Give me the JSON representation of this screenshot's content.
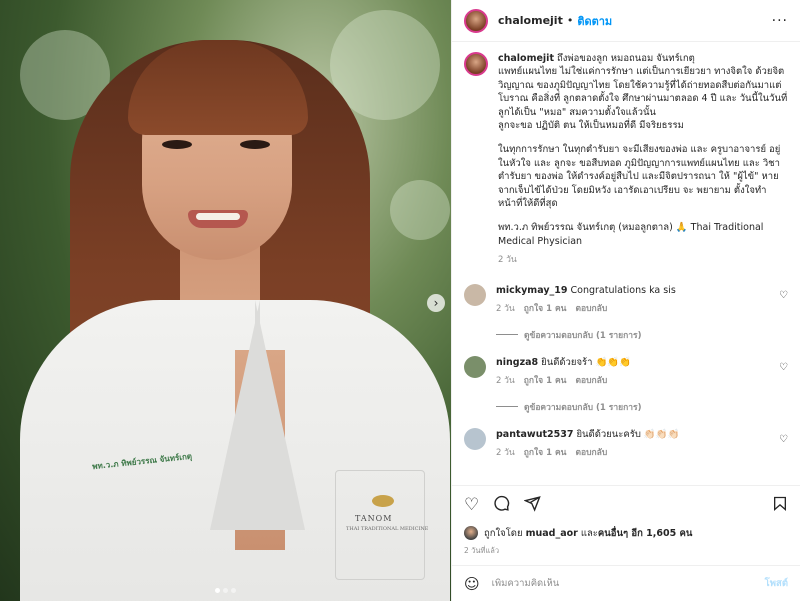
{
  "photo": {
    "embroidery_text": "พท.ว.ภ ทิพย์วรรณ จันทร์เกตุ",
    "logo_name": "TANOM",
    "logo_sub": "THAI TRADITIONAL MEDICINE",
    "next_icon": "chevron-right-icon",
    "dots_count": 3
  },
  "header": {
    "username": "chalomejit",
    "separator": "•",
    "follow_label": "ติดตาม",
    "more_icon": "more-horizontal-icon"
  },
  "caption": {
    "username": "chalomejit",
    "paragraphs": [
      " ถึงพ่อของลูก หมอถนอม จันทร์เกตุ\nแพทย์แผนไทย ไม่ใช่แค่การรักษา แต่เป็นการเยียวยา ทางจิตใจ ด้วยจิตวิญญาณ ของภูมิปัญญาไทย โดยใช้ความรู้ที่ได้ถ่ายทอดสืบต่อกันมาแต่โบราณ คือสิ่งที่ ลูกตลาดตั้งใจ ศึกษาผ่านมาตลอด 4 ปี และ วันนี้ในวันที่ ลูกได้เป็น \"หมอ\" สมความตั้งใจแล้วนั้น\nลูกจะขอ ปฏิบัติ ตน ให้เป็นหมอที่ดี มีจริยธรรม",
      "ในทุกการรักษา ในทุกตำรับยา จะมีเสียงของพ่อ และ ครูบาอาจารย์ อยู่ในหัวใจ และ ลูกจะ ขอสืบทอด ภูมิปัญญาการแพทย์แผนไทย และ วิชาตำรับยา ของพ่อ ให้ดำรงค์อยู่สืบไป และมีจิตปรารถนา ให้ \"ผู้ไข้\" หายจากเจ็บไข้ได้ป่วย โดยมิหวัง เอารัดเอาเปรียบ จะ พยายาม ตั้งใจทำหน้าที่ให้ดีที่สุด",
      "พท.ว.ภ ทิพย์วรรณ จันทร์เกตุ (หมอลูกตาล) 🙏 Thai Traditional Medical Physician"
    ],
    "time": "2 วัน"
  },
  "comments": [
    {
      "username": "mickymay_19",
      "text": " Congratulations ka sis",
      "time": "2 วัน",
      "likes": "ถูกใจ 1 คน",
      "reply_label": "ตอบกลับ",
      "view_replies": "ดูข้อความตอบกลับ (1 รายการ)",
      "avatar_color": "#c9b8a6"
    },
    {
      "username": "ningza8",
      "text": " ยินดีด้วยจร้า 👏👏👏",
      "time": "2 วัน",
      "likes": "ถูกใจ 1 คน",
      "reply_label": "ตอบกลับ",
      "view_replies": "ดูข้อความตอบกลับ (1 รายการ)",
      "avatar_color": "#7a8f6a"
    },
    {
      "username": "pantawut2537",
      "text": " ยินดีด้วยนะครับ 👏🏻👏🏻👏🏻",
      "time": "2 วัน",
      "likes": "ถูกใจ 1 คน",
      "reply_label": "ตอบกลับ",
      "view_replies": "",
      "avatar_color": "#b7c4cf"
    }
  ],
  "actions": {
    "like_icon": "heart-icon",
    "comment_icon": "comment-icon",
    "share_icon": "send-icon",
    "save_icon": "bookmark-icon"
  },
  "likes": {
    "prefix": "ถูกใจโดย ",
    "user": "muad_aor",
    "suffix": " และ",
    "others": "คนอื่นๆ อีก 1,605 คน"
  },
  "time_ago": "2 วันที่แล้ว",
  "add_comment": {
    "emoji_icon": "smiley-icon",
    "placeholder": "เพิ่มความคิดเห็น",
    "post_label": "โพสต์"
  }
}
